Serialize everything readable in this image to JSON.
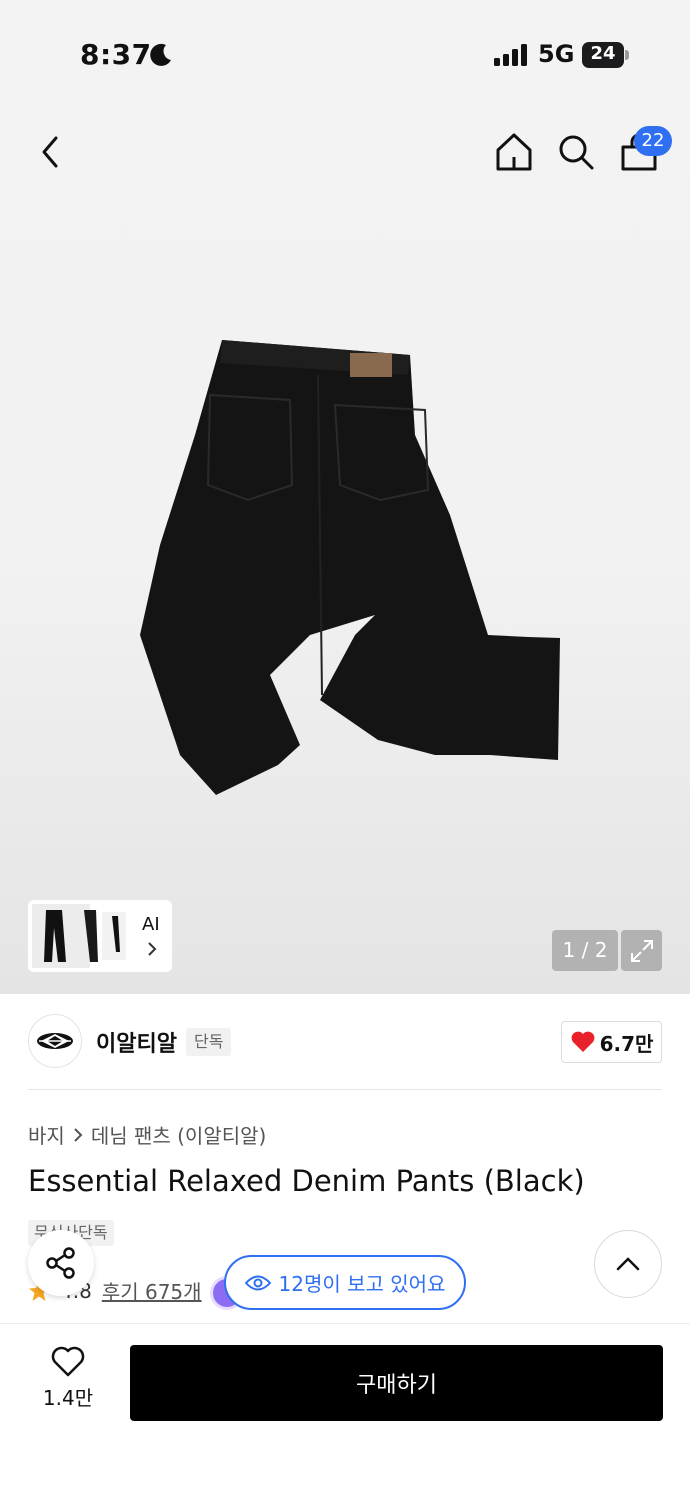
{
  "status_bar": {
    "time": "8:37",
    "network": "5G",
    "battery": "24"
  },
  "nav": {
    "cart_count": "22"
  },
  "gallery": {
    "ai_label": "AI",
    "page_counter": "1 / 2"
  },
  "brand": {
    "name": "이알티알",
    "badge": "단독",
    "likes": "6.7만"
  },
  "breadcrumb": {
    "items": [
      "바지",
      "데님 팬츠 (이알티알)"
    ]
  },
  "product": {
    "title": "Essential Relaxed Denim Pants (Black)",
    "exclusive_tag": "무신사단독",
    "rating": "4.8",
    "reviews": "후기 675개"
  },
  "viewers": {
    "text": "12명이 보고 있어요"
  },
  "bottom_bar": {
    "like_count": "1.4만",
    "buy_label": "구매하기"
  },
  "colors": {
    "accent": "#2f6ff2",
    "heart": "#e8212b",
    "star": "#f5a623",
    "buy_button": "#000000"
  },
  "icons": [
    "moon-icon",
    "signal-icon",
    "battery-icon",
    "back-icon",
    "home-icon",
    "search-icon",
    "cart-icon",
    "chevron-right-icon",
    "expand-icon",
    "heart-icon",
    "share-icon",
    "chevron-up-icon",
    "eye-icon",
    "star-icon"
  ]
}
